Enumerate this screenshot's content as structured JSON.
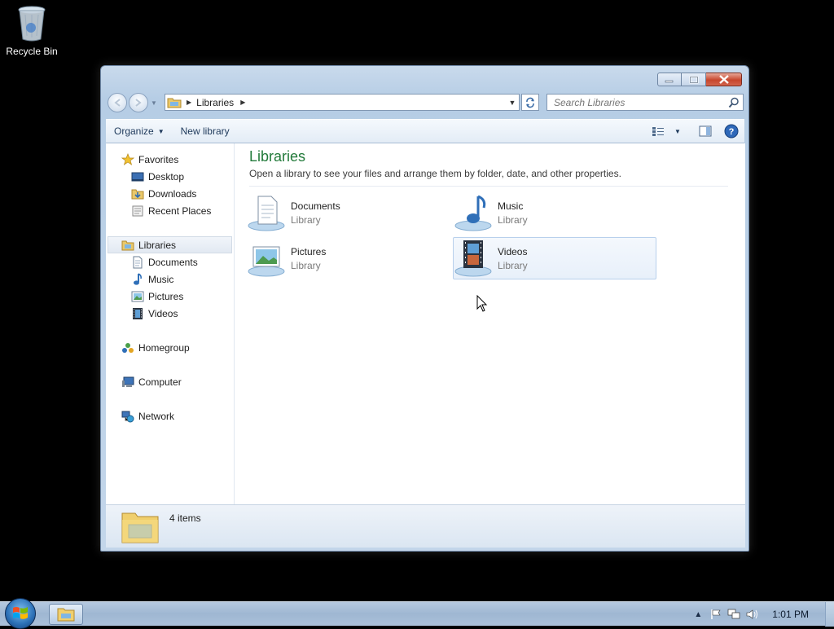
{
  "desktop": {
    "recycle_bin_label": "Recycle Bin"
  },
  "window": {
    "address": {
      "breadcrumb": [
        "Libraries"
      ]
    },
    "search": {
      "placeholder": "Search Libraries"
    },
    "toolbar": {
      "organize_label": "Organize",
      "new_library_label": "New library"
    },
    "navpane": {
      "favorites": {
        "label": "Favorites",
        "items": [
          "Desktop",
          "Downloads",
          "Recent Places"
        ]
      },
      "libraries": {
        "label": "Libraries",
        "items": [
          "Documents",
          "Music",
          "Pictures",
          "Videos"
        ]
      },
      "homegroup_label": "Homegroup",
      "computer_label": "Computer",
      "network_label": "Network"
    },
    "main": {
      "title": "Libraries",
      "subtitle": "Open a library to see your files and arrange them by folder, date, and other properties.",
      "libraries": [
        {
          "name": "Documents",
          "type": "Library"
        },
        {
          "name": "Music",
          "type": "Library"
        },
        {
          "name": "Pictures",
          "type": "Library"
        },
        {
          "name": "Videos",
          "type": "Library"
        }
      ]
    },
    "details": {
      "count": "4 items"
    }
  },
  "taskbar": {
    "clock": "1:01 PM"
  },
  "colors": {
    "title_green": "#227a3a",
    "accent_blue": "#1e5a9c"
  }
}
